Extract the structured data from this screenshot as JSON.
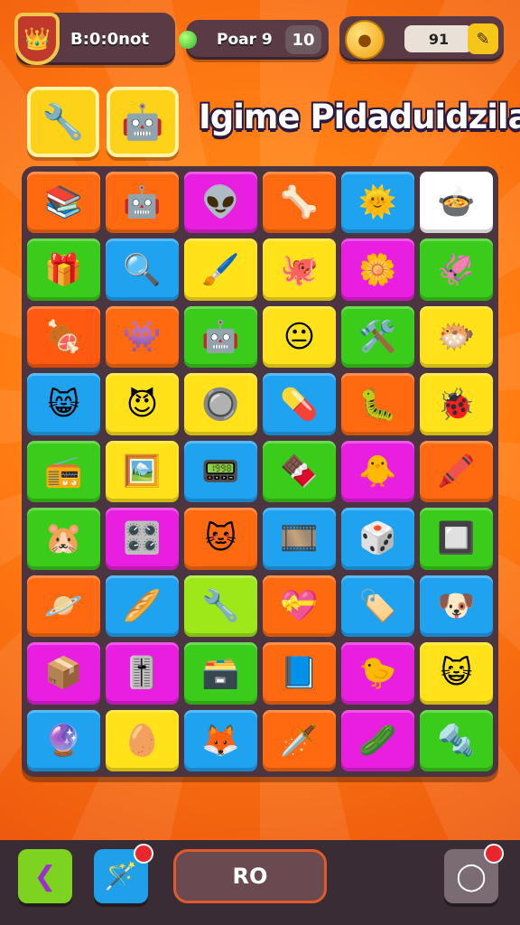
{
  "topbar": {
    "player_label": "B:0:0not",
    "level_label": "Poar 9",
    "level_value": "10",
    "coins_value": "91"
  },
  "header": {
    "title": "Igime Pidaduidzila"
  },
  "board": {
    "tiles": [
      {
        "icon": "📚",
        "bg": "#ff6a10"
      },
      {
        "icon": "🤖",
        "bg": "#ff6a10"
      },
      {
        "icon": "👽",
        "bg": "#e81ee0"
      },
      {
        "icon": "🦴",
        "bg": "#ff6a10"
      },
      {
        "icon": "🌞",
        "bg": "#1fa3f0"
      },
      {
        "icon": "🍲",
        "bg": "#ffffff"
      },
      {
        "icon": "🎁",
        "bg": "#3acc1a"
      },
      {
        "icon": "🔍",
        "bg": "#1fa3f0"
      },
      {
        "icon": "🖌️",
        "bg": "#ffe21a"
      },
      {
        "icon": "🐙",
        "bg": "#ffe21a"
      },
      {
        "icon": "🌼",
        "bg": "#e81ee0"
      },
      {
        "icon": "🦑",
        "bg": "#3acc1a"
      },
      {
        "icon": "🍖",
        "bg": "#ff5a10"
      },
      {
        "icon": "👾",
        "bg": "#ff6a10"
      },
      {
        "icon": "🤖",
        "bg": "#3acc1a"
      },
      {
        "icon": "😐",
        "bg": "#ffe21a"
      },
      {
        "icon": "🛠️",
        "bg": "#3acc1a"
      },
      {
        "icon": "🐡",
        "bg": "#ffe21a"
      },
      {
        "icon": "😸",
        "bg": "#1fa3f0"
      },
      {
        "icon": "😈",
        "bg": "#ffe21a"
      },
      {
        "icon": "🔘",
        "bg": "#ffe21a"
      },
      {
        "icon": "💊",
        "bg": "#1fa3f0"
      },
      {
        "icon": "🐛",
        "bg": "#ff6a10"
      },
      {
        "icon": "🐞",
        "bg": "#ffe21a"
      },
      {
        "icon": "📻",
        "bg": "#3acc1a"
      },
      {
        "icon": "🖼️",
        "bg": "#ffe21a"
      },
      {
        "icon": "📟",
        "bg": "#1fa3f0"
      },
      {
        "icon": "🍫",
        "bg": "#3acc1a"
      },
      {
        "icon": "🐥",
        "bg": "#e81ee0"
      },
      {
        "icon": "🖍️",
        "bg": "#ff6a10"
      },
      {
        "icon": "🐹",
        "bg": "#3acc1a"
      },
      {
        "icon": "🎛️",
        "bg": "#e81ee0"
      },
      {
        "icon": "🐱",
        "bg": "#ff6a10"
      },
      {
        "icon": "🎞️",
        "bg": "#1fa3f0"
      },
      {
        "icon": "🎲",
        "bg": "#1fa3f0"
      },
      {
        "icon": "🔲",
        "bg": "#3acc1a"
      },
      {
        "icon": "🪐",
        "bg": "#ff6a10"
      },
      {
        "icon": "🥖",
        "bg": "#1fa3f0"
      },
      {
        "icon": "🔧",
        "bg": "#9ee81a"
      },
      {
        "icon": "💝",
        "bg": "#ff6a10"
      },
      {
        "icon": "🏷️",
        "bg": "#1fa3f0"
      },
      {
        "icon": "🐶",
        "bg": "#1fa3f0"
      },
      {
        "icon": "📦",
        "bg": "#e81ee0"
      },
      {
        "icon": "🎚️",
        "bg": "#e81ee0"
      },
      {
        "icon": "🗃️",
        "bg": "#3acc1a"
      },
      {
        "icon": "📘",
        "bg": "#ff6a10"
      },
      {
        "icon": "🐤",
        "bg": "#e81ee0"
      },
      {
        "icon": "😺",
        "bg": "#ffe21a"
      },
      {
        "icon": "🔮",
        "bg": "#1fa3f0"
      },
      {
        "icon": "🥚",
        "bg": "#ffe21a"
      },
      {
        "icon": "🦊",
        "bg": "#1fa3f0"
      },
      {
        "icon": "🗡️",
        "bg": "#ff6a10"
      },
      {
        "icon": "🥒",
        "bg": "#e81ee0"
      },
      {
        "icon": "🔩",
        "bg": "#3acc1a"
      }
    ]
  },
  "bottombar": {
    "go_label": "RO"
  },
  "icons": {
    "shield": "shield-crown-icon",
    "gem": "green-gem-icon",
    "coin": "coin-icon",
    "edit": "pencil-icon",
    "tool1": "wrench-tool-icon",
    "tool2": "robot-face-icon",
    "back": "back-arrow-icon",
    "magic": "wand-icon",
    "settings": "settings-icon"
  }
}
